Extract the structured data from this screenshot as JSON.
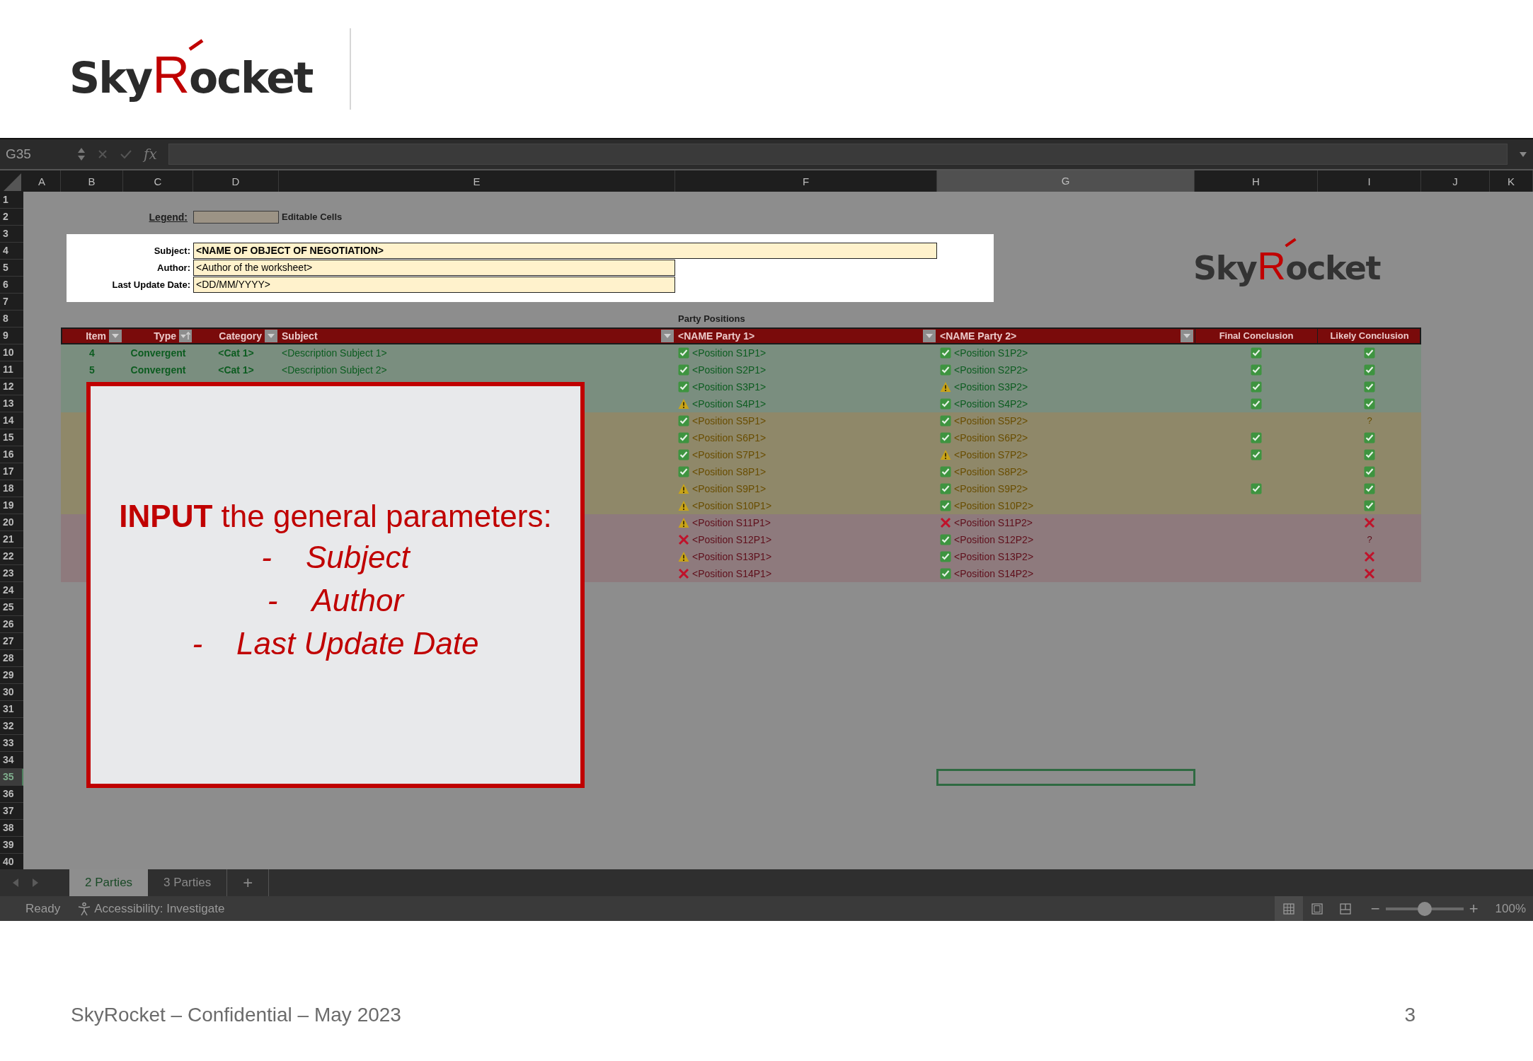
{
  "slide": {
    "logo": {
      "before": "Sky",
      "accent": "R",
      "after": "ocket"
    },
    "footer": "SkyRocket – Confidential – May 2023",
    "page_number": "3"
  },
  "formula_bar": {
    "name_box": "G35",
    "function_label": "fx"
  },
  "columns": [
    {
      "label": "A",
      "selected": false
    },
    {
      "label": "B",
      "selected": false
    },
    {
      "label": "C",
      "selected": false
    },
    {
      "label": "D",
      "selected": false
    },
    {
      "label": "E",
      "selected": false
    },
    {
      "label": "F",
      "selected": false
    },
    {
      "label": "G",
      "selected": true
    },
    {
      "label": "H",
      "selected": false
    },
    {
      "label": "I",
      "selected": false
    },
    {
      "label": "J",
      "selected": false
    },
    {
      "label": "K",
      "selected": false
    }
  ],
  "rows": [
    {
      "label": "1",
      "selected": false
    },
    {
      "label": "2",
      "selected": false
    },
    {
      "label": "3",
      "selected": false
    },
    {
      "label": "4",
      "selected": false
    },
    {
      "label": "5",
      "selected": false
    },
    {
      "label": "6",
      "selected": false
    },
    {
      "label": "7",
      "selected": false
    },
    {
      "label": "8",
      "selected": false
    },
    {
      "label": "9",
      "selected": false
    },
    {
      "label": "10",
      "selected": false
    },
    {
      "label": "11",
      "selected": false
    },
    {
      "label": "12",
      "selected": false
    },
    {
      "label": "13",
      "selected": false
    },
    {
      "label": "14",
      "selected": false
    },
    {
      "label": "15",
      "selected": false
    },
    {
      "label": "16",
      "selected": false
    },
    {
      "label": "17",
      "selected": false
    },
    {
      "label": "18",
      "selected": false
    },
    {
      "label": "19",
      "selected": false
    },
    {
      "label": "20",
      "selected": false
    },
    {
      "label": "21",
      "selected": false
    },
    {
      "label": "22",
      "selected": false
    },
    {
      "label": "23",
      "selected": false
    },
    {
      "label": "24",
      "selected": false
    },
    {
      "label": "25",
      "selected": false
    },
    {
      "label": "26",
      "selected": false
    },
    {
      "label": "27",
      "selected": false
    },
    {
      "label": "28",
      "selected": false
    },
    {
      "label": "29",
      "selected": false
    },
    {
      "label": "30",
      "selected": false
    },
    {
      "label": "31",
      "selected": false
    },
    {
      "label": "32",
      "selected": false
    },
    {
      "label": "33",
      "selected": false
    },
    {
      "label": "34",
      "selected": false
    },
    {
      "label": "35",
      "selected": true
    },
    {
      "label": "36",
      "selected": false
    },
    {
      "label": "37",
      "selected": false
    },
    {
      "label": "38",
      "selected": false
    },
    {
      "label": "39",
      "selected": false
    },
    {
      "label": "40",
      "selected": false
    }
  ],
  "legend": {
    "label": "Legend:",
    "text": "Editable Cells"
  },
  "info": [
    {
      "kind": "title",
      "label": "Subject:",
      "value": "<NAME OF OBJECT OF NEGOTIATION>"
    },
    {
      "kind": "text",
      "label": "Author:",
      "value": "<Author of the worksheet>"
    },
    {
      "kind": "text",
      "label": "Last Update Date:",
      "value": "<DD/MM/YYYY>"
    }
  ],
  "sheet_logo": {
    "before": "Sky",
    "accent": "R",
    "after": "ocket"
  },
  "section_label": "Party Positions",
  "table": {
    "columns": [
      {
        "label": "Item",
        "kind": "filter"
      },
      {
        "label": "Type",
        "kind": "sort"
      },
      {
        "label": "Category",
        "kind": "filter"
      },
      {
        "label": "Subject",
        "kind": "filter"
      },
      {
        "label": "<NAME Party 1>",
        "kind": "filter"
      },
      {
        "label": "<NAME Party 2>",
        "kind": "filter"
      },
      {
        "label": "Final Conclusion",
        "kind": "plain"
      },
      {
        "label": "Likely Conclusion",
        "kind": "plain"
      }
    ],
    "rows": [
      {
        "color": "#7a8e7f",
        "item": "4",
        "type": "Convergent",
        "category": "<Cat 1>",
        "subject": "<Description Subject 1>",
        "party_1": {
          "kind": "check",
          "text": "<Position S1P1>"
        },
        "party_2": {
          "kind": "check",
          "text": "<Position S1P2>"
        },
        "final": {
          "kind": "check"
        },
        "likely": {
          "kind": "check"
        }
      },
      {
        "color": "#7a8e7f",
        "item": "5",
        "type": "Convergent",
        "category": "<Cat 1>",
        "subject": "<Description Subject 2>",
        "party_1": {
          "kind": "check",
          "text": "<Position S2P1>"
        },
        "party_2": {
          "kind": "check",
          "text": "<Position S2P2>"
        },
        "final": {
          "kind": "check"
        },
        "likely": {
          "kind": "check"
        }
      },
      {
        "color": "#7a8e7f",
        "party_1": {
          "kind": "check",
          "text": "<Position S3P1>"
        },
        "party_2": {
          "kind": "warning",
          "text": "<Position S3P2>"
        },
        "final": {
          "kind": "check"
        },
        "likely": {
          "kind": "check"
        }
      },
      {
        "color": "#7a8e7f",
        "party_1": {
          "kind": "warning",
          "text": "<Position S4P1>"
        },
        "party_2": {
          "kind": "check",
          "text": "<Position S4P2>"
        },
        "final": {
          "kind": "check"
        },
        "likely": {
          "kind": "check"
        }
      },
      {
        "color": "#8f8869",
        "party_1": {
          "kind": "check",
          "text": "<Position S5P1>"
        },
        "party_2": {
          "kind": "check",
          "text": "<Position S5P2>"
        },
        "likely": {
          "kind": "text",
          "text": "?"
        }
      },
      {
        "color": "#8f8869",
        "party_1": {
          "kind": "check",
          "text": "<Position S6P1>"
        },
        "party_2": {
          "kind": "check",
          "text": "<Position S6P2>"
        },
        "final": {
          "kind": "check"
        },
        "likely": {
          "kind": "check"
        }
      },
      {
        "color": "#8f8869",
        "party_1": {
          "kind": "check",
          "text": "<Position S7P1>"
        },
        "party_2": {
          "kind": "warning",
          "text": "<Position S7P2>"
        },
        "final": {
          "kind": "check"
        },
        "likely": {
          "kind": "check"
        }
      },
      {
        "color": "#8f8869",
        "party_1": {
          "kind": "check",
          "text": "<Position S8P1>"
        },
        "party_2": {
          "kind": "check",
          "text": "<Position S8P2>"
        },
        "likely": {
          "kind": "check"
        }
      },
      {
        "color": "#8f8869",
        "party_1": {
          "kind": "warning",
          "text": "<Position S9P1>"
        },
        "party_2": {
          "kind": "check",
          "text": "<Position S9P2>"
        },
        "final": {
          "kind": "check"
        },
        "likely": {
          "kind": "check"
        }
      },
      {
        "color": "#8f8869",
        "party_1": {
          "kind": "warning",
          "text": "<Position S10P1>"
        },
        "party_2": {
          "kind": "check",
          "text": "<Position S10P2>"
        },
        "likely": {
          "kind": "check"
        }
      },
      {
        "color": "#8e7a7d",
        "party_1": {
          "kind": "warning",
          "text": "<Position S11P1>"
        },
        "party_2": {
          "kind": "cross",
          "text": "<Position S11P2>"
        },
        "likely": {
          "kind": "cross"
        }
      },
      {
        "color": "#8e7a7d",
        "party_1": {
          "kind": "cross",
          "text": "<Position S12P1>"
        },
        "party_2": {
          "kind": "check",
          "text": "<Position S12P2>"
        },
        "likely": {
          "kind": "text",
          "text": "?"
        }
      },
      {
        "color": "#8e7a7d",
        "party_1": {
          "kind": "warning",
          "text": "<Position S13P1>"
        },
        "party_2": {
          "kind": "check",
          "text": "<Position S13P2>"
        },
        "likely": {
          "kind": "cross"
        }
      },
      {
        "color": "#8e7a7d",
        "party_1": {
          "kind": "cross",
          "text": "<Position S14P1>"
        },
        "party_2": {
          "kind": "check",
          "text": "<Position S14P2>"
        },
        "likely": {
          "kind": "cross"
        }
      }
    ]
  },
  "callout": {
    "heading": "**INPUT** the general parameters:",
    "items": [
      {
        "bullet": "-",
        "text": "Subject"
      },
      {
        "bullet": "-",
        "text": "Author"
      },
      {
        "bullet": "-",
        "text": "Last Update Date"
      }
    ]
  },
  "sheet_tabs": [
    {
      "label": "2 Parties",
      "selected": true
    },
    {
      "label": "3 Parties",
      "selected": false
    }
  ],
  "add_sheet": "+",
  "status_bar": {
    "ready": "Ready",
    "accessibility": "Accessibility: Investigate",
    "views": [
      {
        "kind": "normal",
        "selected": true
      },
      {
        "kind": "page-layout",
        "selected": false
      },
      {
        "kind": "page-break",
        "selected": false
      }
    ],
    "zoom": {
      "minus": "−",
      "plus": "+",
      "level": 0.5,
      "reading": "100%"
    }
  }
}
